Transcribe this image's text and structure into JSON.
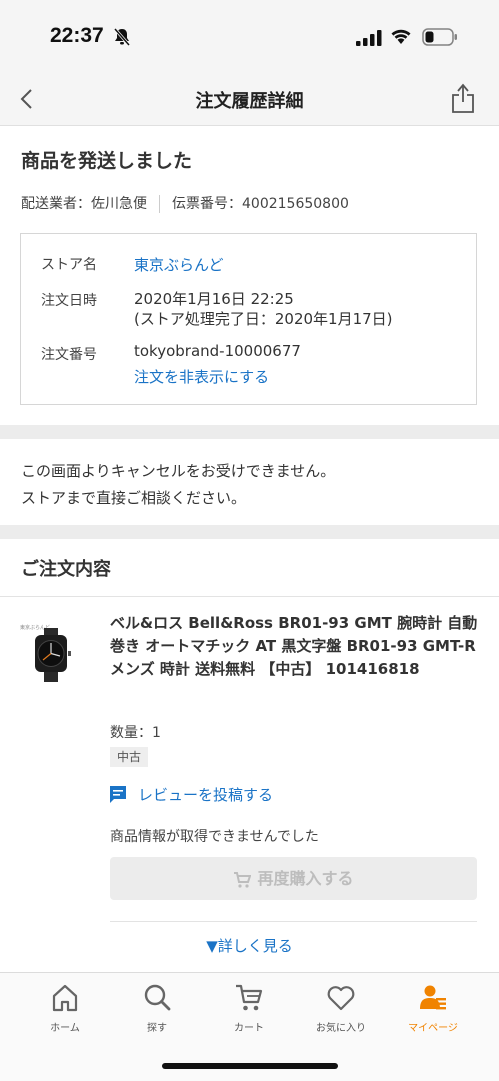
{
  "status_bar": {
    "time": "22:37"
  },
  "nav": {
    "title": "注文履歴詳細"
  },
  "shipping": {
    "heading": "商品を発送しました",
    "carrier": "配送業者：佐川急便",
    "tracking": "伝票番号：400215650800"
  },
  "store_box": {
    "store_label": "ストア名",
    "store_name": "東京ぶらんど",
    "date_label": "注文日時",
    "date_value": "2020年1月16日 22:25",
    "date_note": "(ストア処理完了日：2020年1月17日)",
    "order_label": "注文番号",
    "order_number": "tokyobrand-10000677",
    "hide_link": "注文を非表示にする"
  },
  "notice": {
    "line1": "この画面よりキャンセルをお受けできません。",
    "line2": "ストアまで直接ご相談ください。"
  },
  "order": {
    "heading": "ご注文内容",
    "product_title": "ベル&ロス Bell&Ross BR01-93 GMT 腕時計 自動巻き オートマチック AT 黒文字盤 BR01-93 GMT-R メンズ 時計 送料無料 【中古】 101416818",
    "quantity": "数量：1",
    "condition": "中古",
    "review_link": "レビューを投稿する",
    "unavailable": "商品情報が取得できませんでした",
    "rebuy_button": "再度購入する",
    "more_link": "▼詳しく見る"
  },
  "tabs": [
    {
      "label": "ホーム",
      "icon": "home-icon"
    },
    {
      "label": "探す",
      "icon": "search-icon"
    },
    {
      "label": "カート",
      "icon": "cart-icon"
    },
    {
      "label": "お気に入り",
      "icon": "heart-icon"
    },
    {
      "label": "マイページ",
      "icon": "user-icon"
    }
  ],
  "colors": {
    "link": "#1a73c6",
    "accent": "#f08300"
  }
}
